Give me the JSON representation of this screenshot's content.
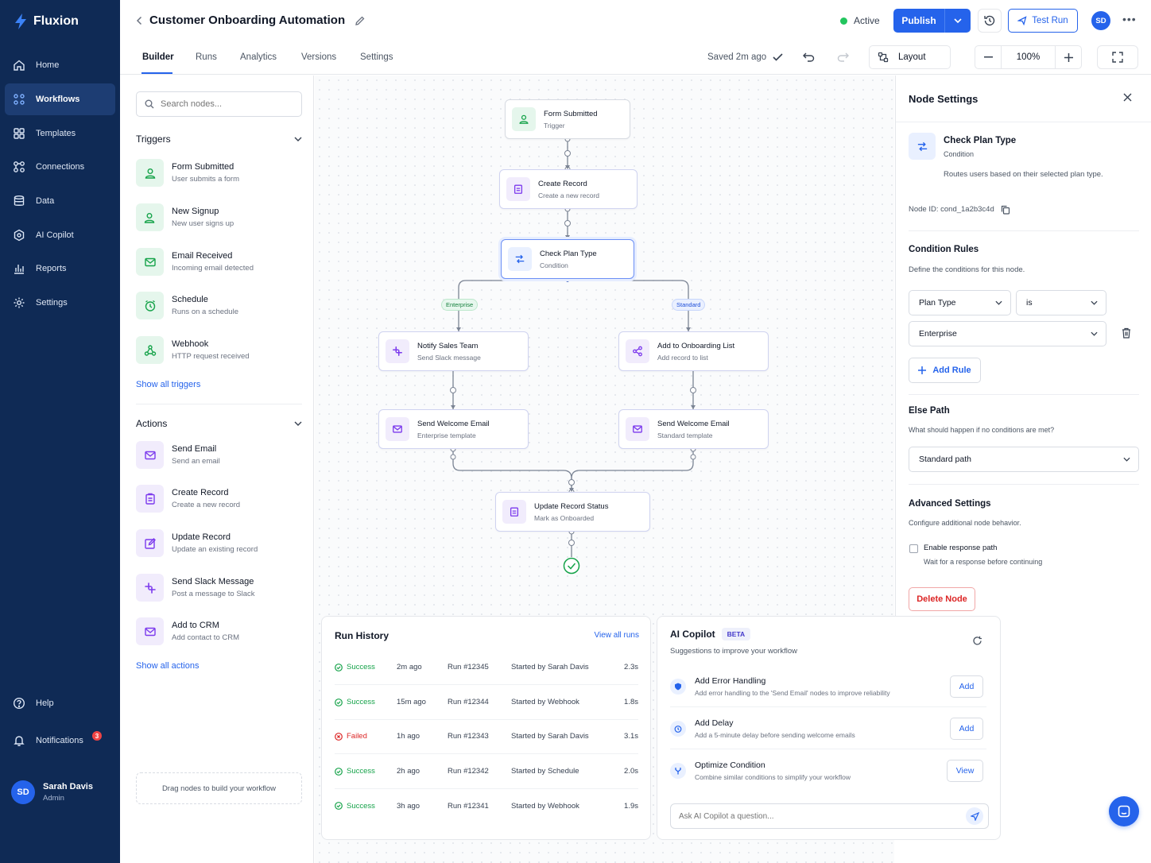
{
  "brand": {
    "name": "Fluxion"
  },
  "sidebar": {
    "items": [
      {
        "label": "Home",
        "icon": "home-icon"
      },
      {
        "label": "Workflows",
        "icon": "workflows-icon",
        "active": true
      },
      {
        "label": "Templates",
        "icon": "templates-icon"
      },
      {
        "label": "Connections",
        "icon": "connections-icon"
      },
      {
        "label": "Data",
        "icon": "data-icon"
      },
      {
        "label": "AI Copilot",
        "icon": "ai-copilot-icon"
      },
      {
        "label": "Reports",
        "icon": "reports-icon"
      },
      {
        "label": "Settings",
        "icon": "gear-icon"
      }
    ],
    "help": "Help",
    "notifications": "Notifications",
    "notifications_count": "3",
    "user": {
      "initials": "SD",
      "name": "Sarah Davis",
      "role": "Admin"
    }
  },
  "header": {
    "title": "Customer Onboarding Automation",
    "status": "Active",
    "publish": "Publish",
    "test_run": "Test Run",
    "avatar": "SD"
  },
  "tabs": [
    "Builder",
    "Runs",
    "Analytics",
    "Versions",
    "Settings"
  ],
  "toolbar": {
    "saved": "Saved 2m ago",
    "layout": "Layout",
    "zoom": "100%"
  },
  "left": {
    "search_placeholder": "Search nodes...",
    "triggers_title": "Triggers",
    "triggers": [
      {
        "title": "Form Submitted",
        "desc": "User submits a form"
      },
      {
        "title": "New Signup",
        "desc": "New user signs up"
      },
      {
        "title": "Email Received",
        "desc": "Incoming email detected"
      },
      {
        "title": "Schedule",
        "desc": "Runs on a schedule"
      },
      {
        "title": "Webhook",
        "desc": "HTTP request received"
      }
    ],
    "show_triggers": "Show all triggers",
    "actions_title": "Actions",
    "actions": [
      {
        "title": "Send Email",
        "desc": "Send an email"
      },
      {
        "title": "Create Record",
        "desc": "Create a new record"
      },
      {
        "title": "Update Record",
        "desc": "Update an existing record"
      },
      {
        "title": "Send Slack Message",
        "desc": "Post a message to Slack"
      },
      {
        "title": "Add to CRM",
        "desc": "Add contact to CRM"
      }
    ],
    "show_actions": "Show all actions",
    "drag_hint": "Drag nodes to build your workflow"
  },
  "flow": {
    "nodes": [
      {
        "title": "Form Submitted",
        "sub": "Trigger"
      },
      {
        "title": "Create Record",
        "sub": "Create a new record"
      },
      {
        "title": "Check Plan Type",
        "sub": "Condition"
      },
      {
        "title": "Notify Sales Team",
        "sub": "Send Slack message"
      },
      {
        "title": "Add to Onboarding List",
        "sub": "Add record to list"
      },
      {
        "title": "Send Welcome Email",
        "sub": "Enterprise template"
      },
      {
        "title": "Send Welcome Email",
        "sub": "Standard template"
      },
      {
        "title": "Update Record Status",
        "sub": "Mark as Onboarded"
      }
    ],
    "branch_left": "Enterprise",
    "branch_right": "Standard"
  },
  "runs": {
    "title": "Run History",
    "view_all": "View all runs",
    "rows": [
      {
        "status": "Success",
        "ago": "2m ago",
        "run": "Run #12345",
        "by": "Started by Sarah Davis",
        "dur": "2.3s"
      },
      {
        "status": "Success",
        "ago": "15m ago",
        "run": "Run #12344",
        "by": "Started by Webhook",
        "dur": "1.8s"
      },
      {
        "status": "Failed",
        "ago": "1h ago",
        "run": "Run #12343",
        "by": "Started by Sarah Davis",
        "dur": "3.1s"
      },
      {
        "status": "Success",
        "ago": "2h ago",
        "run": "Run #12342",
        "by": "Started by Schedule",
        "dur": "2.0s"
      },
      {
        "status": "Success",
        "ago": "3h ago",
        "run": "Run #12341",
        "by": "Started by Webhook",
        "dur": "1.9s"
      }
    ]
  },
  "copilot": {
    "title": "AI Copilot",
    "badge": "BETA",
    "subtitle": "Suggestions to improve your workflow",
    "suggestions": [
      {
        "title": "Add Error Handling",
        "desc": "Add error handling to the 'Send Email' nodes to improve reliability",
        "action": "Add"
      },
      {
        "title": "Add Delay",
        "desc": "Add a 5-minute delay before sending welcome emails",
        "action": "Add"
      },
      {
        "title": "Optimize Condition",
        "desc": "Combine similar conditions to simplify your workflow",
        "action": "View"
      }
    ],
    "ask_placeholder": "Ask AI Copilot a question..."
  },
  "settings": {
    "title": "Node Settings",
    "node_title": "Check Plan Type",
    "node_type": "Condition",
    "node_desc": "Routes users based on their selected plan type.",
    "node_id": "Node ID: cond_1a2b3c4d",
    "rules_title": "Condition Rules",
    "rules_desc": "Define the conditions for this node.",
    "field": "Plan Type",
    "operator": "is",
    "value": "Enterprise",
    "add_rule": "Add Rule",
    "else_title": "Else Path",
    "else_desc": "What should happen if no conditions are met?",
    "else_value": "Standard path",
    "adv_title": "Advanced Settings",
    "adv_desc": "Configure additional node behavior.",
    "enable_label": "Enable response path",
    "enable_desc": "Wait for a response before continuing",
    "delete": "Delete Node"
  },
  "colors": {
    "sidebar": "#0f2a55",
    "accent": "#2563eb",
    "success": "#16a34a",
    "danger": "#dc2626"
  }
}
